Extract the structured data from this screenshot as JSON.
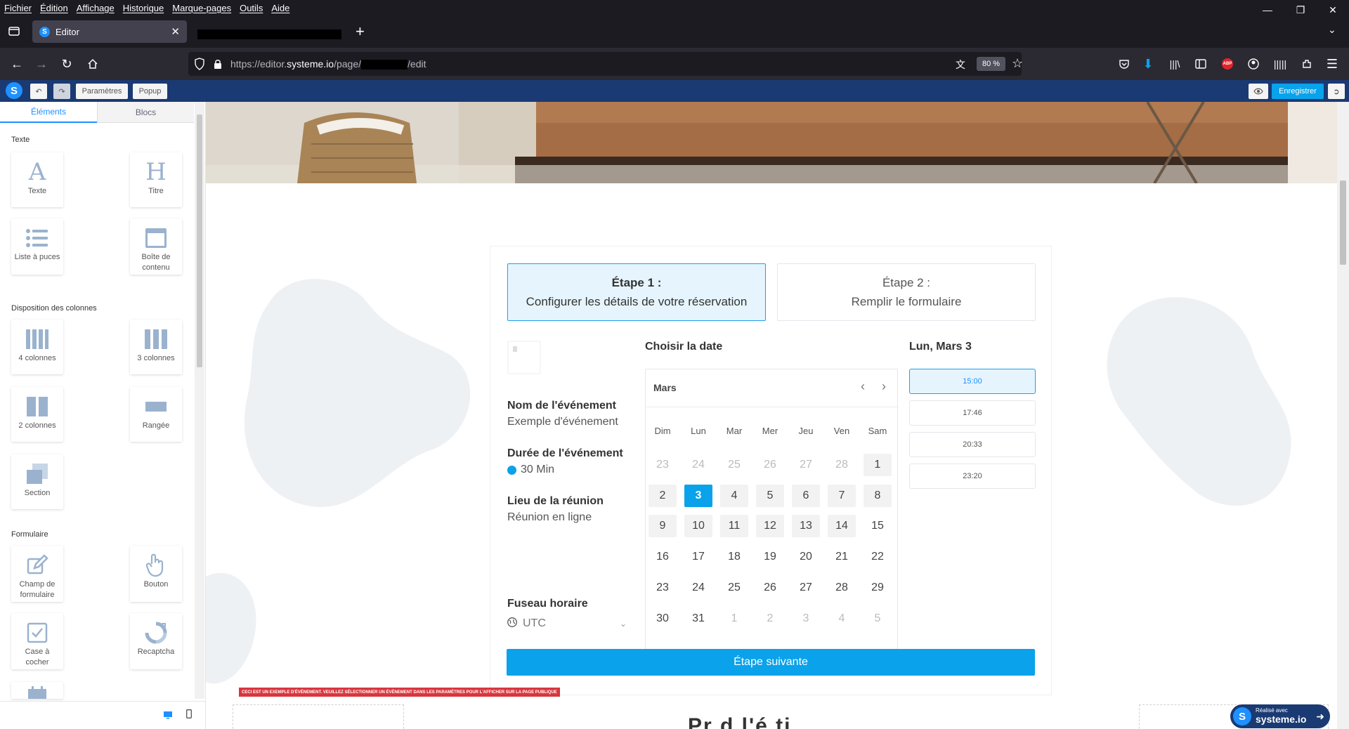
{
  "browser": {
    "menu": [
      "Fichier",
      "Édition",
      "Affichage",
      "Historique",
      "Marque-pages",
      "Outils",
      "Aide"
    ],
    "tab_title": "Editor",
    "url_prefix": "https://editor.",
    "url_domain": "systeme.io",
    "url_path": "/page/",
    "url_suffix": "/edit",
    "zoom": "80 %",
    "abp_label": "ABP"
  },
  "editor_toolbar": {
    "logo": "S",
    "settings_label": "Paramètres",
    "popup_label": "Popup",
    "save_label": "Enregistrer"
  },
  "left_panel": {
    "tabs": [
      "Éléments",
      "Blocs"
    ],
    "sections": {
      "text": "Texte",
      "columns": "Disposition des colonnes",
      "form": "Formulaire"
    },
    "elements": {
      "texte": "Texte",
      "titre": "Titre",
      "liste": "Liste à puces",
      "boite": "Boîte de contenu",
      "col4": "4 colonnes",
      "col3": "3 colonnes",
      "col2": "2 colonnes",
      "rangee": "Rangée",
      "section": "Section",
      "champ": "Champ de formulaire",
      "bouton": "Bouton",
      "case": "Case à cocher",
      "recaptcha": "Recaptcha"
    }
  },
  "booking": {
    "step1_title": "Étape 1 :",
    "step1_desc": "Configurer les détails de votre réservation",
    "step2_title": "Étape 2 :",
    "step2_desc": "Remplir le formulaire",
    "event_name_label": "Nom de l'événement",
    "event_name_value": "Exemple d'événement",
    "duration_label": "Durée de l'événement",
    "duration_value": "30 Min",
    "location_label": "Lieu de la réunion",
    "location_value": "Réunion en ligne",
    "timezone_label": "Fuseau horaire",
    "timezone_value": "UTC",
    "choose_date": "Choisir la date",
    "selected_date": "Lun, Mars 3",
    "month": "Mars",
    "weekdays": [
      "Dim",
      "Lun",
      "Mar",
      "Mer",
      "Jeu",
      "Ven",
      "Sam"
    ],
    "slots": [
      "15:00",
      "17:46",
      "20:33",
      "23:20"
    ],
    "next_label": "Étape suivante",
    "warning": "CECI EST UN EXEMPLE D'ÉVÉNEMENT. VEUILLEZ SÉLECTIONNER UN ÉVÉNEMENT DANS LES PARAMÈTRES POUR L'AFFICHER SUR LA PAGE PUBLIQUE",
    "page_heading_fragment": "Pr d l'é    ti",
    "badge_small": "Réalisé avec",
    "badge_brand": "systeme.io"
  },
  "calendar": {
    "rows": [
      [
        "23",
        "24",
        "25",
        "26",
        "27",
        "28",
        "1"
      ],
      [
        "2",
        "3",
        "4",
        "5",
        "6",
        "7",
        "8"
      ],
      [
        "9",
        "10",
        "11",
        "12",
        "13",
        "14",
        "15"
      ],
      [
        "16",
        "17",
        "18",
        "19",
        "20",
        "21",
        "22"
      ],
      [
        "23",
        "24",
        "25",
        "26",
        "27",
        "28",
        "29"
      ],
      [
        "30",
        "31",
        "1",
        "2",
        "3",
        "4",
        "5"
      ]
    ]
  },
  "colors": {
    "accent": "#0aa2ea",
    "toolbar": "#1a3a73",
    "selected_bg": "#e6f5fd",
    "warning": "#d9363e"
  }
}
